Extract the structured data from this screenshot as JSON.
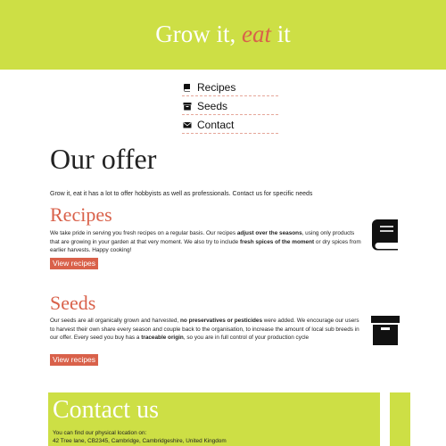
{
  "header": {
    "brand_pre": "Grow it, ",
    "brand_accent": "eat",
    "brand_post": " it"
  },
  "nav": {
    "items": [
      {
        "label": "Recipes",
        "icon": "book-icon"
      },
      {
        "label": "Seeds",
        "icon": "box-icon"
      },
      {
        "label": "Contact",
        "icon": "envelope-icon"
      }
    ]
  },
  "main": {
    "title": "Our offer",
    "intro": "Grow it, eat it has a lot to offer hobbyists as well as professionals. Contact us for specific needs"
  },
  "recipes": {
    "title": "Recipes",
    "body": [
      "We take pride in serving you fresh recipes on a regular basis. Our recipes ",
      "adjust over the seasons",
      ", using only products that are growing in your garden at that very moment. We also try to include ",
      "fresh spices of the moment",
      " or dry spices from earlier harvests. Happy cooking!"
    ],
    "button": "View recipes",
    "icon": "book-icon"
  },
  "seeds": {
    "title": "Seeds",
    "body": [
      "Our seeds are all organically grown and harvested, ",
      "no preservatives or pesticides",
      " were added. We encourage our users to harvest their own share every season and couple back to the organisation, to increase the amount of local sub breeds in our offer. Every seed you buy has a ",
      "traceable origin",
      ", so you are in full control of your production cycle"
    ],
    "button": "View recipes",
    "icon": "box-icon"
  },
  "contact": {
    "title": "Contact us",
    "line1": "You can find our physical location on:",
    "line2": "42 Tree lane, CB2345, Cambridge, Cambridgeshire, United Kingdom"
  },
  "colors": {
    "brand_green": "#cddf45",
    "accent": "#d9614a"
  }
}
